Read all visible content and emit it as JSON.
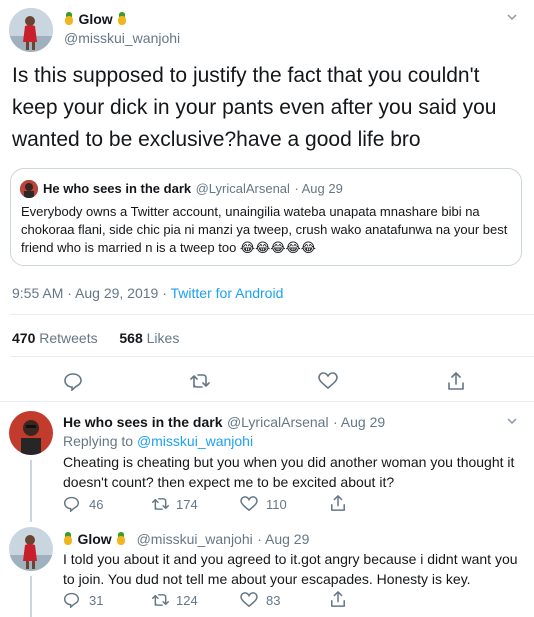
{
  "main_tweet": {
    "author_name": "Glow",
    "author_handle": "@misskui_wanjohi",
    "text": "Is this supposed to justify the fact that you couldn't keep your dick in your pants even after you said you wanted to be exclusive?have a good life bro",
    "quoted": {
      "author_name": "He who sees in the dark",
      "author_handle": "@LyricalArsenal",
      "date": "· Aug 29",
      "text": "Everybody owns a Twitter account, unaingilia wateba unapata mnashare bibi na chokoraa flani, side chic pia ni manzi ya tweep, crush wako anatafunwa na your best friend who is married n is a tweep too 😂😂😂😂😂"
    },
    "timestamp": "9:55 AM · Aug 29, 2019 · ",
    "client": "Twitter for Android",
    "retweets_count": "470",
    "retweets_label": "Retweets",
    "likes_count": "568",
    "likes_label": "Likes"
  },
  "replies": [
    {
      "author_name": "He who sees in the dark",
      "author_handle": "@LyricalArsenal",
      "date": "· Aug 29",
      "replying_to_label": "Replying to",
      "replying_to_handle": "@misskui_wanjohi",
      "text": "Cheating is cheating but you when you did another woman you thought it doesn't count? then expect me to be excited about it?",
      "replies": "46",
      "retweets": "174",
      "likes": "110"
    },
    {
      "author_name": "Glow",
      "author_handle": "@misskui_wanjohi",
      "date": "· Aug 29",
      "text": "I told you about it and you agreed to it.got angry because i didnt want you to join. You dud not tell me about your escapades. Honesty is key.",
      "replies": "31",
      "retweets": "124",
      "likes": "83"
    }
  ],
  "icons": {
    "more": "chevron-down-icon",
    "reply": "reply-icon",
    "retweet": "retweet-icon",
    "like": "like-icon",
    "share": "share-icon"
  },
  "colors": {
    "link": "#1da1f2",
    "muted": "#657786",
    "text": "#14171a",
    "border": "#e6ecf0"
  }
}
